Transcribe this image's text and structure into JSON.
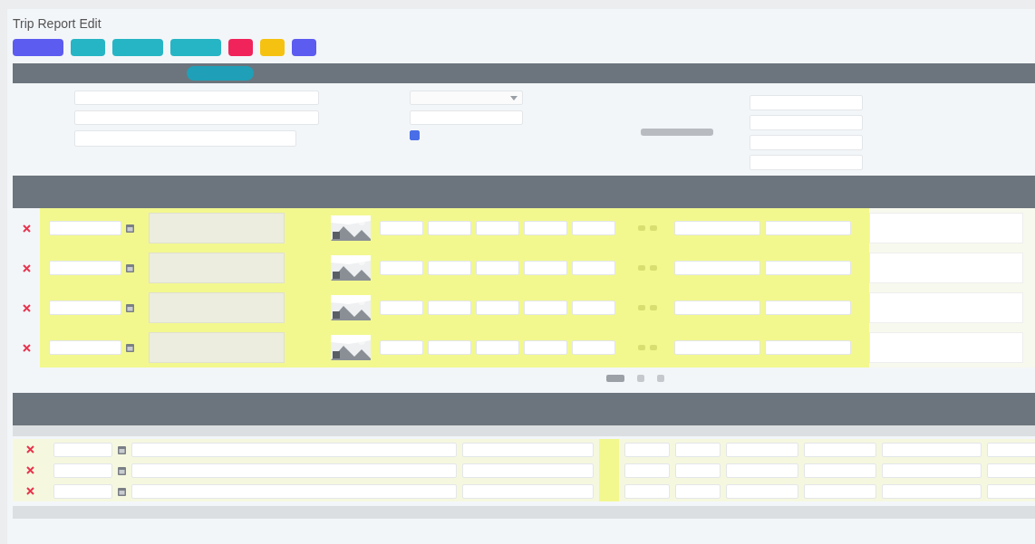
{
  "window": {
    "title": "Trip Report Edit"
  },
  "toolbar": {
    "buttons": [
      {
        "color": "#5c5cf0"
      },
      {
        "color": "#26b5c5"
      },
      {
        "color": "#26b5c5"
      },
      {
        "color": "#26b5c5"
      },
      {
        "color": "#f0245a"
      },
      {
        "color": "#f5c211"
      },
      {
        "color": "#5c5cf0"
      }
    ]
  },
  "form": {
    "left_fields": [
      {
        "kind": "input"
      },
      {
        "kind": "input"
      },
      {
        "kind": "note"
      }
    ],
    "middle_fields": [
      {
        "kind": "select"
      },
      {
        "kind": "input"
      }
    ],
    "checkbox": {
      "checked": true
    },
    "right_fields": [
      {
        "kind": "input"
      },
      {
        "kind": "input"
      },
      {
        "kind": "input"
      },
      {
        "kind": "input"
      }
    ]
  },
  "trips": {
    "rows": [
      {
        "kind": "entry",
        "highlighted": true
      },
      {
        "kind": "entry",
        "highlighted": true
      },
      {
        "kind": "entry",
        "highlighted": true
      },
      {
        "kind": "entry",
        "highlighted": true
      }
    ]
  },
  "pager": [
    {
      "selected": true
    },
    {
      "selected": false
    },
    {
      "selected": false
    }
  ],
  "expenses": {
    "rows": [
      {
        "kind": "entry",
        "highlighted": true
      },
      {
        "kind": "entry",
        "highlighted": true
      },
      {
        "kind": "entry",
        "highlighted": true
      }
    ]
  }
}
